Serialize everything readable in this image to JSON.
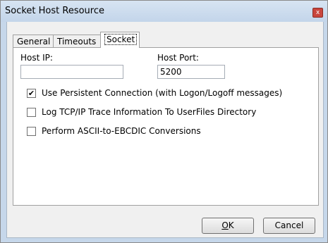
{
  "window": {
    "title": "Socket Host Resource",
    "close_glyph": "x"
  },
  "tabs": [
    {
      "label": "General"
    },
    {
      "label": "Timeouts"
    },
    {
      "label": "Socket"
    }
  ],
  "socket": {
    "host_ip": {
      "label": "Host IP:",
      "value": ""
    },
    "host_port": {
      "label": "Host Port:",
      "value": "5200"
    },
    "options": [
      {
        "label": "Use Persistent Connection (with Logon/Logoff messages)",
        "checked": true,
        "mark": "✔"
      },
      {
        "label": "Log TCP/IP Trace Information To UserFiles Directory",
        "checked": false,
        "mark": ""
      },
      {
        "label": "Perform ASCII-to-EBCDIC Conversions",
        "checked": false,
        "mark": ""
      }
    ]
  },
  "buttons": {
    "ok": {
      "mnemonic": "O",
      "rest": "K"
    },
    "cancel": "Cancel"
  }
}
